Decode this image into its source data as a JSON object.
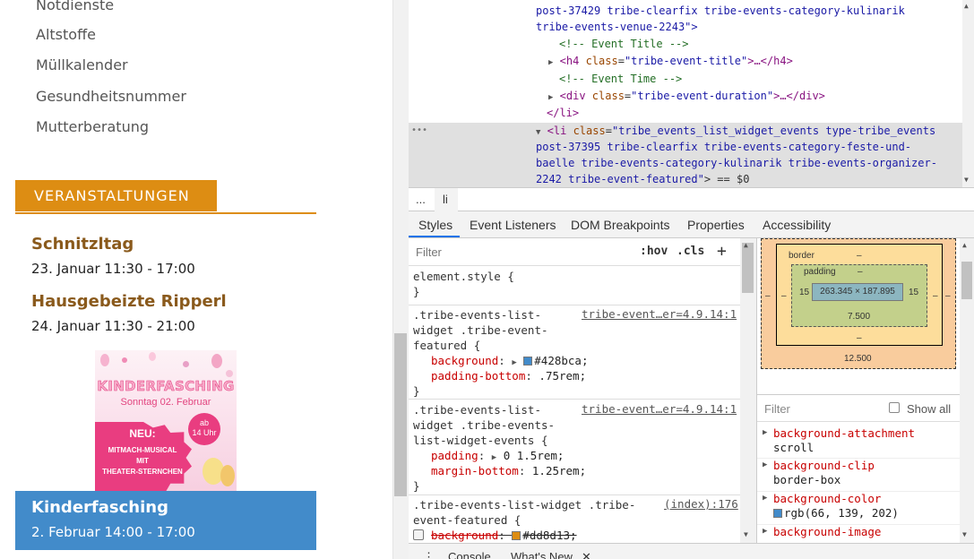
{
  "site": {
    "nav_items": [
      "Notdienste",
      "Altstoffe",
      "Müllkalender",
      "Gesundheitsnummer",
      "Mutterberatung"
    ],
    "section_title": "VERANSTALTUNGEN",
    "events": [
      {
        "title": "Schnitzltag",
        "time": "23. Januar 11:30 - 17:00"
      },
      {
        "title": "Hausgebeizte Ripperl",
        "time": "24. Januar 11:30 - 21:00"
      }
    ],
    "poster": {
      "title": "KINDERFASCHING",
      "subtitle": "Sonntag 02. Februar",
      "badge_line1": "ab",
      "badge_line2": "14 Uhr",
      "neu": "NEU:",
      "line1": "MITMACH-MUSICAL",
      "line2": "MIT",
      "line3": "THEATER-STERNCHEN"
    },
    "featured": {
      "title": "Kinderfasching",
      "time": "2. Februar 14:00 - 17:00"
    },
    "colors": {
      "accent": "#dd8d13",
      "featured_bg": "#428bca",
      "event_title": "#8a5a1c"
    }
  },
  "devtools": {
    "dom": {
      "l1": "post-37429 tribe-clearfix tribe-events-category-kulinarik",
      "l2": "tribe-events-venue-2243\">",
      "c1": "<!-- Event Title -->",
      "h4_open": "<h4",
      "h4_attr": "class",
      "h4_val": "\"tribe-event-title\"",
      "h4_close": ">…</h4>",
      "c2": "<!-- Event Time -->",
      "div_open": "<div",
      "div_attr": "class",
      "div_val": "\"tribe-event-duration\"",
      "div_close": ">…</div>",
      "li_close": "</li>",
      "sel_open": "<li",
      "sel_attr": "class",
      "sel_val1": "\"tribe_events_list_widget_events type-tribe_events",
      "sel_val2": "post-37395 tribe-clearfix tribe-events-category-feste-und-",
      "sel_val3": "baelle tribe-events-category-kulinarik tribe-events-organizer-",
      "sel_val4": "2242 tribe-event-featured\"",
      "sel_end": "> == $0",
      "dots": "•••"
    },
    "breadcrumbs": [
      "...",
      "li"
    ],
    "tabs": [
      "Styles",
      "Event Listeners",
      "DOM Breakpoints",
      "Properties",
      "Accessibility"
    ],
    "active_tab": "Styles",
    "styles": {
      "filter_placeholder": "Filter",
      "hov": ":hov",
      "cls": ".cls",
      "plus": "+",
      "element_style": "element.style {",
      "close": "}",
      "rule1": {
        "sel1": ".tribe-events-list-",
        "sel2": "widget .tribe-event-",
        "sel3": "featured {",
        "source": "tribe-event…er=4.9.14:1",
        "p1": "background",
        "v1": "#428bca;",
        "c1": "#428bca",
        "p2": "padding-bottom",
        "v2": ".75rem;"
      },
      "rule2": {
        "sel1": ".tribe-events-list-",
        "sel2": "widget .tribe-events-",
        "sel3": "list-widget-events {",
        "source": "tribe-event…er=4.9.14:1",
        "p1": "padding",
        "v1": "0 1.5rem;",
        "p2": "margin-bottom",
        "v2": "1.25rem;"
      },
      "rule3": {
        "sel1": ".tribe-events-list-widget .tribe-",
        "sel2": "event-featured {",
        "source": "(index):176",
        "p1": "background",
        "v1": "#dd8d13;",
        "c1": "#dd8d13"
      }
    },
    "box_model": {
      "border_label": "border",
      "border_value": "–",
      "padding_label": "padding",
      "padding_value": "–",
      "content": "263.345 × 187.895",
      "padding_left": "15",
      "padding_right": "15",
      "padding_bottom": "7.500",
      "margin_left": "–",
      "margin_right": "–",
      "border_left": "–",
      "border_right": "–",
      "border_bottom": "–",
      "margin_bottom": "12.500"
    },
    "computed_filter": {
      "placeholder": "Filter",
      "show_all": "Show all"
    },
    "computed": [
      {
        "name": "background-attachment",
        "value": "scroll"
      },
      {
        "name": "background-clip",
        "value": "border-box"
      },
      {
        "name": "background-color",
        "value": "rgb(66, 139, 202)",
        "color": "#428bca"
      },
      {
        "name": "background-image",
        "value": ""
      }
    ],
    "drawer": {
      "menu": "⋮",
      "console": "Console",
      "whats_new": "What's New",
      "close": "✕"
    }
  }
}
